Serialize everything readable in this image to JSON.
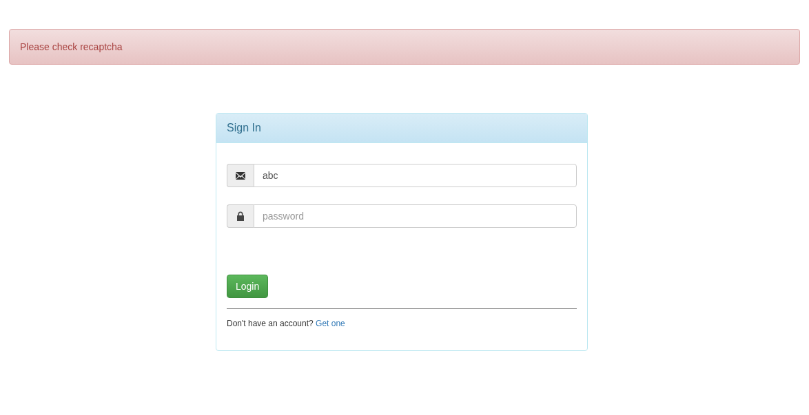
{
  "alert": {
    "message": "Please check recaptcha"
  },
  "panel": {
    "title": "Sign In",
    "fields": [
      {
        "kind": "email",
        "value": "abc"
      },
      {
        "kind": "password",
        "placeholder": "password"
      }
    ],
    "button": "Login",
    "footer": {
      "text": "Don't have an account?",
      "link": "Get one"
    }
  }
}
